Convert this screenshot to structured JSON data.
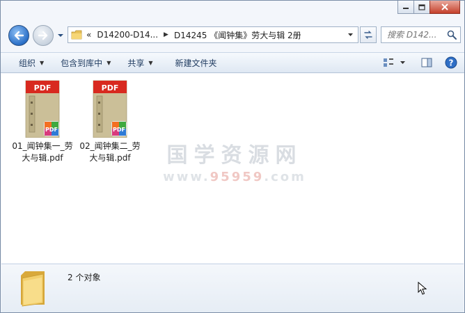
{
  "window": {
    "caption_buttons": [
      "minimize",
      "maximize",
      "close"
    ]
  },
  "address_bar": {
    "overflow_glyph": "«",
    "crumbs": [
      "D14200-D14...",
      "D14245 《闻钟集》劳大与辑 2册"
    ]
  },
  "search": {
    "placeholder": "搜索 D142..."
  },
  "toolbar": {
    "organize_label": "组织",
    "include_label": "包含到库中",
    "share_label": "共享",
    "new_folder_label": "新建文件夹"
  },
  "files": [
    {
      "name": "01_闻钟集一_劳大与辑.pdf",
      "badge": "PDF",
      "badge_color": "#d8291f"
    },
    {
      "name": "02_闻钟集二_劳大与辑.pdf",
      "badge": "PDF",
      "badge_color": "#d8291f"
    }
  ],
  "watermark": {
    "line1": "国学资源网",
    "line2_a": "www.",
    "line2_b": "95959",
    "line2_c": ".com"
  },
  "status": {
    "item_count": "2 个对象"
  }
}
